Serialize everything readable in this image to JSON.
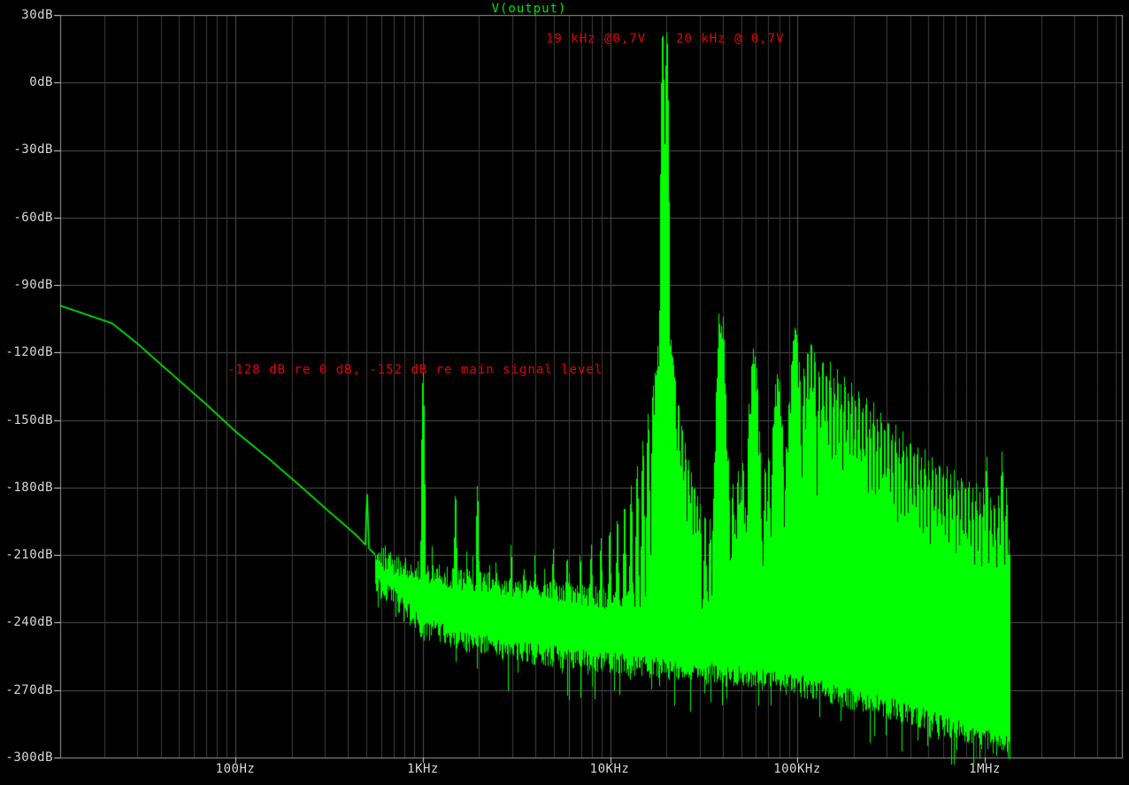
{
  "chart_data": {
    "type": "line",
    "title": "V(output)",
    "series": [
      {
        "name": "V(output)",
        "color": "#00ff00"
      }
    ],
    "x_axis": {
      "scale": "log",
      "unit": "Hz",
      "ticks": [
        "100Hz",
        "1KHz",
        "10KHz",
        "100KHz",
        "1MHz"
      ],
      "range_hz": [
        11.5,
        5400000
      ],
      "trace_end_hz": 1350000
    },
    "y_axis": {
      "unit": "dB",
      "step_db": 30,
      "range_db": [
        -300,
        30
      ],
      "ticks": [
        "30dB",
        "0dB",
        "-30dB",
        "-60dB",
        "-90dB",
        "-120dB",
        "-150dB",
        "-180dB",
        "-210dB",
        "-240dB",
        "-270dB",
        "-300dB"
      ]
    },
    "annotations": [
      {
        "text": "19 kHz @0,7V",
        "color": "#e60000"
      },
      {
        "text": "20 kHz @ 0,7V",
        "color": "#e60000"
      },
      {
        "text": "-128 dB re 0 dB, -152 dB re main signal level",
        "color": "#e60000"
      }
    ],
    "main_tones": [
      {
        "freq_hz": 19000,
        "level_db": 23
      },
      {
        "freq_hz": 20000,
        "level_db": 23
      }
    ],
    "imd_1khz_db": -128,
    "lf_rolloff": [
      [
        11.5,
        -99
      ],
      [
        22,
        -107
      ],
      [
        30,
        -116
      ],
      [
        45,
        -129
      ],
      [
        70,
        -143
      ],
      [
        100,
        -155
      ],
      [
        150,
        -167
      ],
      [
        220,
        -179
      ],
      [
        320,
        -191
      ],
      [
        440,
        -201
      ],
      [
        560,
        -210
      ]
    ],
    "noise_top": [
      [
        560,
        -212
      ],
      [
        700,
        -216
      ],
      [
        1000,
        -220
      ],
      [
        2000,
        -224
      ],
      [
        5000,
        -228
      ],
      [
        10000,
        -231
      ],
      [
        20000,
        -233
      ],
      [
        50000,
        -234
      ],
      [
        100000,
        -237
      ],
      [
        200000,
        -243
      ],
      [
        400000,
        -249
      ],
      [
        700000,
        -253
      ],
      [
        1000000,
        -256
      ],
      [
        1350000,
        -259
      ]
    ],
    "noise_bottom": [
      [
        560,
        -218
      ],
      [
        700,
        -224
      ],
      [
        1000,
        -238
      ],
      [
        1500,
        -242
      ],
      [
        2000,
        -245
      ],
      [
        3000,
        -248
      ],
      [
        5000,
        -250
      ],
      [
        10000,
        -253
      ],
      [
        20000,
        -256
      ],
      [
        50000,
        -259
      ],
      [
        100000,
        -263
      ],
      [
        200000,
        -269
      ],
      [
        300000,
        -273
      ],
      [
        400000,
        -276
      ],
      [
        500000,
        -279
      ],
      [
        700000,
        -283
      ],
      [
        900000,
        -286
      ],
      [
        1100000,
        -288
      ],
      [
        1350000,
        -291
      ]
    ],
    "forest_top": [
      [
        35000,
        -210
      ],
      [
        38000,
        -190
      ],
      [
        43000,
        -208
      ],
      [
        50000,
        -205
      ],
      [
        58000,
        -196
      ],
      [
        65000,
        -208
      ],
      [
        78000,
        -200
      ],
      [
        85000,
        -207
      ],
      [
        97000,
        -192
      ],
      [
        110000,
        -188
      ],
      [
        130000,
        -186
      ],
      [
        160000,
        -188
      ],
      [
        200000,
        -190
      ],
      [
        250000,
        -192
      ],
      [
        300000,
        -194
      ],
      [
        400000,
        -198
      ],
      [
        500000,
        -202
      ],
      [
        600000,
        -205
      ],
      [
        700000,
        -208
      ],
      [
        800000,
        -210
      ],
      [
        900000,
        -212
      ],
      [
        1000000,
        -213
      ],
      [
        1100000,
        -210
      ],
      [
        1200000,
        -207
      ],
      [
        1350000,
        -210
      ]
    ],
    "peaks": [
      [
        505,
        -183
      ],
      [
        1000,
        -128
      ],
      [
        1490,
        -182
      ],
      [
        1950,
        -179
      ],
      [
        2450,
        -213
      ],
      [
        2950,
        -205
      ],
      [
        3450,
        -215
      ],
      [
        3950,
        -210
      ],
      [
        4450,
        -216
      ],
      [
        4950,
        -207
      ],
      [
        5900,
        -212
      ],
      [
        6900,
        -209
      ],
      [
        7900,
        -205
      ],
      [
        8900,
        -202
      ],
      [
        9900,
        -198
      ],
      [
        10900,
        -193
      ],
      [
        11900,
        -187
      ],
      [
        12900,
        -179
      ],
      [
        13900,
        -170
      ],
      [
        14900,
        -159
      ],
      [
        15900,
        -147
      ],
      [
        16900,
        -134
      ],
      [
        17400,
        -127
      ],
      [
        17900,
        -117
      ],
      [
        18400,
        -110
      ],
      [
        19000,
        23
      ],
      [
        19500,
        -98
      ],
      [
        20000,
        23
      ],
      [
        20600,
        -106
      ],
      [
        21100,
        -114
      ],
      [
        21600,
        -121
      ],
      [
        22100,
        -129
      ],
      [
        23100,
        -141
      ],
      [
        24100,
        -151
      ],
      [
        25100,
        -160
      ],
      [
        26100,
        -167
      ],
      [
        27100,
        -173
      ],
      [
        28100,
        -178
      ],
      [
        29100,
        -183
      ],
      [
        30100,
        -187
      ],
      [
        32000,
        -191
      ],
      [
        34000,
        -194
      ],
      [
        36000,
        -168
      ],
      [
        37000,
        -131
      ],
      [
        38000,
        -102
      ],
      [
        39000,
        -107
      ],
      [
        40000,
        -104
      ],
      [
        41000,
        -133
      ],
      [
        42500,
        -165
      ],
      [
        45000,
        -178
      ],
      [
        48000,
        -172
      ],
      [
        51000,
        -168
      ],
      [
        55000,
        -142
      ],
      [
        57000,
        -123
      ],
      [
        58000,
        -118
      ],
      [
        59000,
        -121
      ],
      [
        60500,
        -127
      ],
      [
        62500,
        -155
      ],
      [
        67000,
        -170
      ],
      [
        70000,
        -165
      ],
      [
        74000,
        -150
      ],
      [
        76000,
        -134
      ],
      [
        78000,
        -128
      ],
      [
        80000,
        -132
      ],
      [
        82500,
        -150
      ],
      [
        87000,
        -160
      ],
      [
        90000,
        -140
      ],
      [
        93000,
        -122
      ],
      [
        95000,
        -112
      ],
      [
        97000,
        -107
      ],
      [
        99000,
        -111
      ],
      [
        102000,
        -124
      ],
      [
        108000,
        -126
      ],
      [
        113000,
        -118
      ],
      [
        118000,
        -114
      ],
      [
        123000,
        -119
      ],
      [
        130000,
        -127
      ],
      [
        136000,
        -122
      ],
      [
        142000,
        -128
      ],
      [
        149000,
        -124
      ],
      [
        156000,
        -131
      ],
      [
        163000,
        -127
      ],
      [
        170000,
        -134
      ],
      [
        178000,
        -130
      ],
      [
        186000,
        -137
      ],
      [
        194000,
        -133
      ],
      [
        203000,
        -140
      ],
      [
        212000,
        -136
      ],
      [
        222000,
        -143
      ],
      [
        232000,
        -139
      ],
      [
        243000,
        -146
      ],
      [
        254000,
        -142
      ],
      [
        266000,
        -149
      ],
      [
        278000,
        -146
      ],
      [
        291000,
        -152
      ],
      [
        304000,
        -149
      ],
      [
        318000,
        -155
      ],
      [
        333000,
        -152
      ],
      [
        348000,
        -158
      ],
      [
        364000,
        -155
      ],
      [
        381000,
        -161
      ],
      [
        399000,
        -158
      ],
      [
        417000,
        -163
      ],
      [
        436000,
        -161
      ],
      [
        456000,
        -166
      ],
      [
        477000,
        -163
      ],
      [
        499000,
        -168
      ],
      [
        522000,
        -166
      ],
      [
        546000,
        -170
      ],
      [
        571000,
        -168
      ],
      [
        597000,
        -172
      ],
      [
        625000,
        -170
      ],
      [
        654000,
        -174
      ],
      [
        684000,
        -172
      ],
      [
        716000,
        -176
      ],
      [
        749000,
        -174
      ],
      [
        783000,
        -178
      ],
      [
        819000,
        -176
      ],
      [
        857000,
        -180
      ],
      [
        896000,
        -178
      ],
      [
        937000,
        -182
      ],
      [
        980000,
        -180
      ],
      [
        1020000,
        -166
      ],
      [
        1070000,
        -184
      ],
      [
        1120000,
        -186
      ],
      [
        1180000,
        -183
      ],
      [
        1230000,
        -164
      ],
      [
        1300000,
        -180
      ]
    ],
    "colors": {
      "background": "#000000",
      "trace": "#00ff00",
      "title": "#00e400",
      "annotation": "#e60000",
      "grid_minor": "#3d3d3d",
      "grid_major": "#505050",
      "border": "#9a9a9a",
      "tick_text": "#d8d8d8"
    }
  }
}
